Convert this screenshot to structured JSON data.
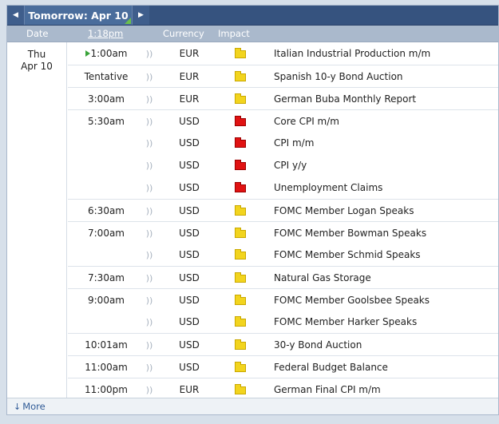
{
  "nav": {
    "prev_glyph": "◀",
    "next_glyph": "▶",
    "title": "Tomorrow: Apr 10"
  },
  "columns": {
    "date": "Date",
    "time": "1:18pm",
    "currency": "Currency",
    "impact": "Impact"
  },
  "date_cell": {
    "weekday": "Thu",
    "date": "Apr 10"
  },
  "colors": {
    "low_impact": "#f2d41e",
    "high_impact": "#e01212",
    "header": "#36537f"
  },
  "events": [
    {
      "time": "1:00am",
      "currency": "EUR",
      "impact": "low",
      "name": "Italian Industrial Production m/m",
      "now": true
    },
    {
      "time": "Tentative",
      "currency": "EUR",
      "impact": "low",
      "name": "Spanish 10-y Bond Auction"
    },
    {
      "time": "3:00am",
      "currency": "EUR",
      "impact": "low",
      "name": "German Buba Monthly Report"
    },
    {
      "time": "5:30am",
      "currency": "USD",
      "impact": "high",
      "name": "Core CPI m/m"
    },
    {
      "time": "",
      "currency": "USD",
      "impact": "high",
      "name": "CPI m/m"
    },
    {
      "time": "",
      "currency": "USD",
      "impact": "high",
      "name": "CPI y/y"
    },
    {
      "time": "",
      "currency": "USD",
      "impact": "high",
      "name": "Unemployment Claims"
    },
    {
      "time": "6:30am",
      "currency": "USD",
      "impact": "low",
      "name": "FOMC Member Logan Speaks"
    },
    {
      "time": "7:00am",
      "currency": "USD",
      "impact": "low",
      "name": "FOMC Member Bowman Speaks"
    },
    {
      "time": "",
      "currency": "USD",
      "impact": "low",
      "name": "FOMC Member Schmid Speaks"
    },
    {
      "time": "7:30am",
      "currency": "USD",
      "impact": "low",
      "name": "Natural Gas Storage"
    },
    {
      "time": "9:00am",
      "currency": "USD",
      "impact": "low",
      "name": "FOMC Member Goolsbee Speaks"
    },
    {
      "time": "",
      "currency": "USD",
      "impact": "low",
      "name": "FOMC Member Harker Speaks"
    },
    {
      "time": "10:01am",
      "currency": "USD",
      "impact": "low",
      "name": "30-y Bond Auction"
    },
    {
      "time": "11:00am",
      "currency": "USD",
      "impact": "low",
      "name": "Federal Budget Balance"
    },
    {
      "time": "11:00pm",
      "currency": "EUR",
      "impact": "low",
      "name": "German Final CPI m/m"
    }
  ],
  "footer": {
    "more_label": "More",
    "more_glyph": "↓"
  }
}
